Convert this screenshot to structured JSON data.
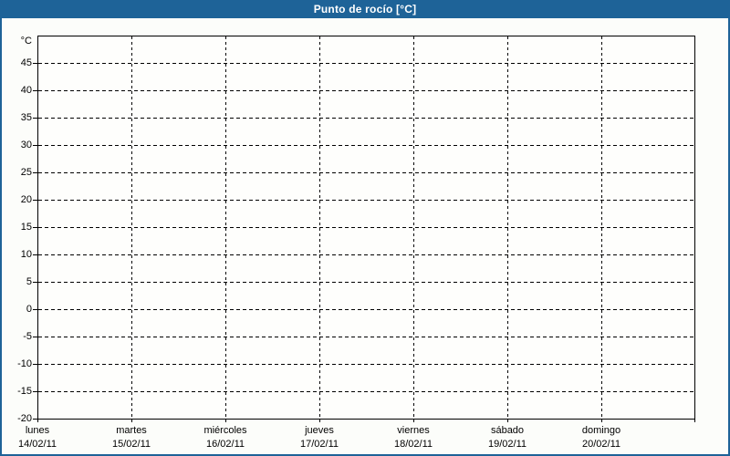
{
  "window": {
    "title": "Punto de rocío [°C]"
  },
  "chart_data": {
    "type": "line",
    "title": "Punto de rocío [°C]",
    "ylabel": "°C",
    "ylim": [
      -20,
      50
    ],
    "ytick_step": 5,
    "yticks": [
      45,
      40,
      35,
      30,
      25,
      20,
      15,
      10,
      5,
      0,
      -5,
      -10,
      -15,
      -20
    ],
    "grid": "dashed",
    "legend": "none",
    "x_categories": [
      {
        "day": "lunes",
        "date": "14/02/11"
      },
      {
        "day": "martes",
        "date": "15/02/11"
      },
      {
        "day": "miércoles",
        "date": "16/02/11"
      },
      {
        "day": "jueves",
        "date": "17/02/11"
      },
      {
        "day": "viernes",
        "date": "18/02/11"
      },
      {
        "day": "sábado",
        "date": "19/02/11"
      },
      {
        "day": "domingo",
        "date": "20/02/11"
      }
    ],
    "series": []
  },
  "colors": {
    "titlebar_bg": "#1e6398",
    "titlebar_text": "#ffffff",
    "window_bg": "#fcfdfa",
    "plot_bg": "#fefefc",
    "grid": "#000000",
    "label_text": "#000000"
  }
}
